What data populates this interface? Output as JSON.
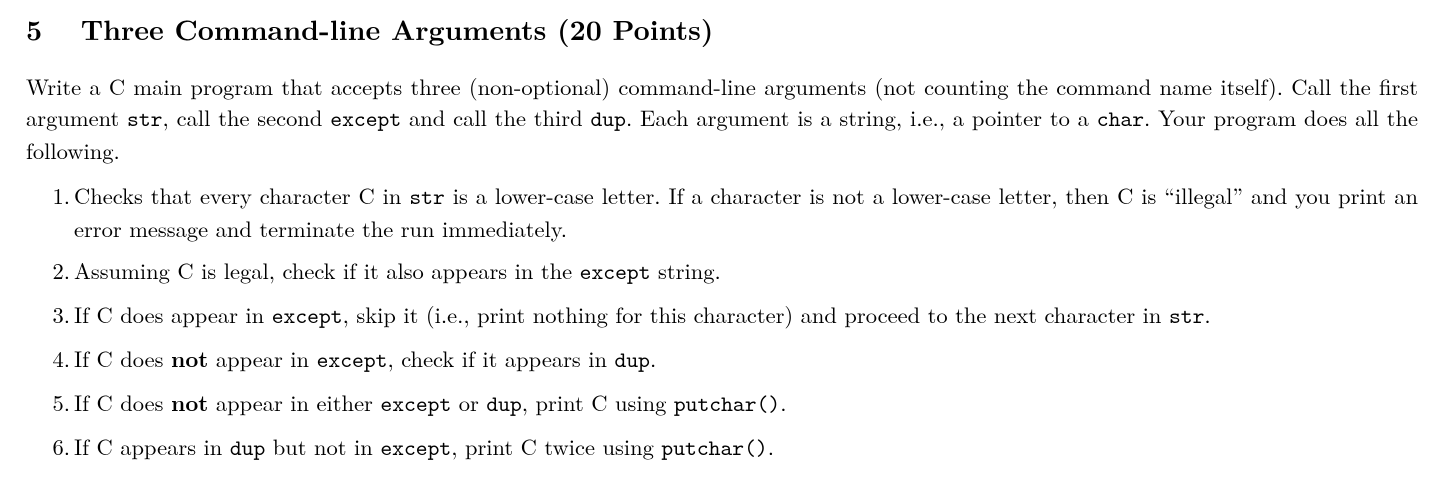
{
  "section": {
    "number": "5",
    "title_pre": "Three Command-line Arguments (",
    "points": "20 Points",
    "title_post": ")"
  },
  "intro": {
    "t1": "Write a C main program that accepts three (non-optional) command-line arguments (not counting the command name itself). Call the first argument ",
    "code1": "str",
    "t2": ", call the second ",
    "code2": "except",
    "t3": " and call the third ",
    "code3": "dup",
    "t4": ". Each argument is a string, i.e., a pointer to a ",
    "code4": "char",
    "t5": ". Your program does all the following."
  },
  "items": {
    "i1": {
      "a": "Checks that every character C in ",
      "code1": "str",
      "b": " is a lower-case letter. If a character is not a lower-case letter, then C is “illegal” and you print an error message and terminate the run immediately."
    },
    "i2": {
      "a": "Assuming C is legal, check if it also appears in the ",
      "code1": "except",
      "b": " string."
    },
    "i3": {
      "a": "If C does appear in ",
      "code1": "except",
      "b": ", skip it (i.e., print nothing for this character) and proceed to the next character in ",
      "code2": "str",
      "c": "."
    },
    "i4": {
      "a": "If C does ",
      "bold1": "not",
      "b": " appear in ",
      "code1": "except",
      "c": ", check if it appears in ",
      "code2": "dup",
      "d": "."
    },
    "i5": {
      "a": "If C does ",
      "bold1": "not",
      "b": " appear in either ",
      "code1": "except",
      "c": " or ",
      "code2": "dup",
      "d": ", print C using ",
      "code3": "putchar()",
      "e": "."
    },
    "i6": {
      "a": "If C appears in ",
      "code1": "dup",
      "b": " but not in ",
      "code2": "except",
      "c": ", print C twice using ",
      "code3": "putchar()",
      "d": "."
    }
  }
}
